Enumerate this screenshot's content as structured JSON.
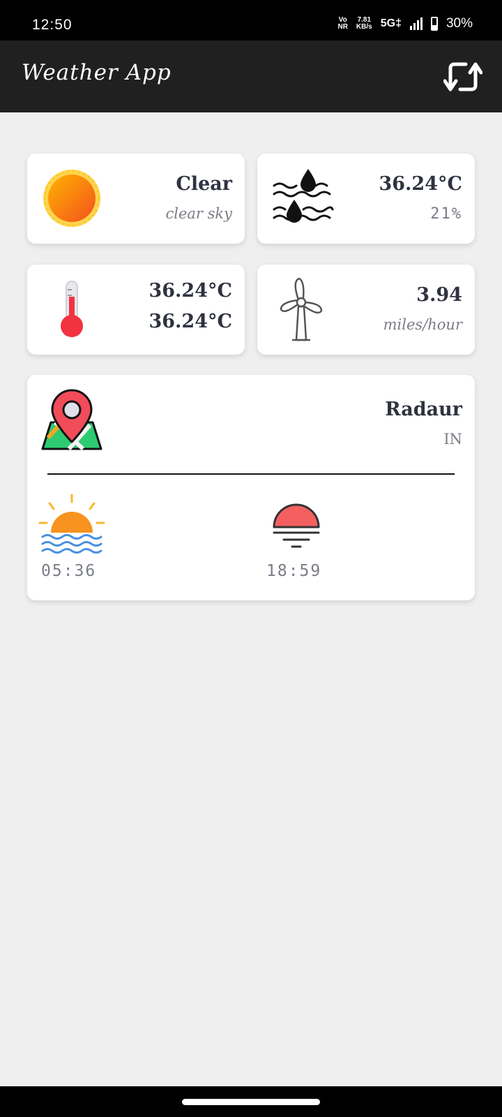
{
  "status_bar": {
    "time": "12:50",
    "volte_top": "Vo",
    "volte_bottom": "NR",
    "speed_value": "7.81",
    "speed_unit": "KB/s",
    "network": "5G‡",
    "battery": "30%"
  },
  "app_bar": {
    "title": "Weather App",
    "refresh_icon": "refresh-icon"
  },
  "weather": {
    "condition": "Clear",
    "description": "clear sky",
    "icon": "sun-icon"
  },
  "humidity": {
    "temperature": "36.24°C",
    "percent": "21%",
    "icon": "humidity-waves-icon"
  },
  "temperature": {
    "max": "36.24°C",
    "min": "36.24°C",
    "icon": "thermometer-icon"
  },
  "wind": {
    "speed": "3.94",
    "unit": "miles/hour",
    "icon": "wind-turbine-icon"
  },
  "location": {
    "city": "Radaur",
    "country": "IN",
    "icon": "map-pin-icon"
  },
  "sun": {
    "sunrise": "05:36",
    "sunset": "18:59",
    "sunrise_icon": "sunrise-icon",
    "sunset_icon": "sunset-icon"
  },
  "colors": {
    "app_bar": "#202020",
    "background": "#efefef",
    "card": "#ffffff",
    "primary_text": "#2f3240",
    "secondary_text": "#7a7d88"
  }
}
